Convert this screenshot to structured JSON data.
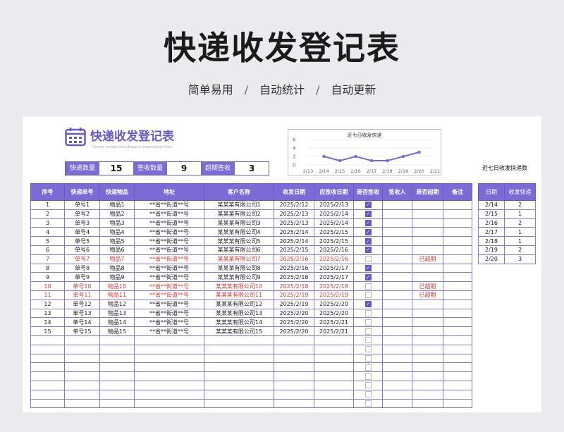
{
  "header": {
    "title": "快递收发登记表",
    "tags": [
      "简单易用",
      "自动统计",
      "自动更新"
    ],
    "separator": "/"
  },
  "sheet": {
    "title": "快递收发登记表",
    "subtitle": "Courier receipt and dispatch registration form",
    "stats": [
      {
        "label": "快递数量",
        "value": "15"
      },
      {
        "label": "签收数量",
        "value": "9"
      },
      {
        "label": "超期签收",
        "value": "3"
      }
    ],
    "side_caption": "近七日收发快递数"
  },
  "columns": [
    "序号",
    "快递单号",
    "快递物品",
    "地址",
    "客户名称",
    "收发日期",
    "应签收日期",
    "是否签收",
    "签收人",
    "是否超期",
    "备注"
  ],
  "rows": [
    [
      "1",
      "单号1",
      "物品1",
      "**省**街道**号",
      "某某某有限公司1",
      "2025/2/12",
      "2025/2/13",
      "on",
      "",
      ""
    ],
    [
      "2",
      "单号2",
      "物品2",
      "**省**街道**号",
      "某某某有限公司2",
      "2025/2/13",
      "2025/2/14",
      "on",
      "",
      ""
    ],
    [
      "3",
      "单号3",
      "物品3",
      "**省**街道**号",
      "某某某有限公司3",
      "2025/2/13",
      "2025/2/14",
      "on",
      "",
      ""
    ],
    [
      "4",
      "单号4",
      "物品4",
      "**省**街道**号",
      "某某某有限公司4",
      "2025/2/14",
      "2025/2/15",
      "on",
      "",
      ""
    ],
    [
      "5",
      "单号5",
      "物品5",
      "**省**街道**号",
      "某某某有限公司5",
      "2025/2/14",
      "2025/2/15",
      "on",
      "",
      ""
    ],
    [
      "6",
      "单号6",
      "物品6",
      "**省**街道**号",
      "某某某有限公司6",
      "2025/2/15",
      "2025/2/16",
      "on",
      "",
      ""
    ],
    [
      "7",
      "单号7",
      "物品7",
      "**省**街道**号",
      "某某某有限公司7",
      "2025/2/16",
      "2025/2/16",
      "off",
      "",
      "已超期"
    ],
    [
      "8",
      "单号8",
      "物品8",
      "**省**街道**号",
      "某某某有限公司8",
      "2025/2/16",
      "2025/2/17",
      "on",
      "",
      ""
    ],
    [
      "9",
      "单号9",
      "物品9",
      "**省**街道**号",
      "某某某有限公司9",
      "2025/2/16",
      "2025/2/17",
      "on",
      "",
      ""
    ],
    [
      "10",
      "单号10",
      "物品10",
      "**省**街道**号",
      "某某某有限公司10",
      "2025/2/18",
      "2025/2/18",
      "off",
      "",
      "已超期"
    ],
    [
      "11",
      "单号11",
      "物品11",
      "**省**街道**号",
      "某某某有限公司11",
      "2025/2/19",
      "2025/2/19",
      "off",
      "",
      "已超期"
    ],
    [
      "12",
      "单号12",
      "物品12",
      "**省**街道**号",
      "某某某有限公司12",
      "2025/2/19",
      "2025/2/20",
      "on",
      "",
      ""
    ],
    [
      "13",
      "单号13",
      "物品13",
      "**省**街道**号",
      "某某某有限公司13",
      "2025/2/20",
      "2025/2/20",
      "off",
      "",
      ""
    ],
    [
      "14",
      "单号14",
      "物品14",
      "**省**街道**号",
      "某某某有限公司14",
      "2025/2/20",
      "2025/2/21",
      "off",
      "",
      ""
    ],
    [
      "15",
      "单号15",
      "物品15",
      "**省**街道**号",
      "某某某有限公司15",
      "2025/2/20",
      "2025/2/21",
      "off",
      "",
      ""
    ]
  ],
  "empty_rows": 8,
  "side_table": {
    "columns": [
      "日期",
      "收发快递"
    ],
    "rows": [
      [
        "2/14",
        "2"
      ],
      [
        "2/15",
        "1"
      ],
      [
        "2/16",
        "2"
      ],
      [
        "2/17",
        "1"
      ],
      [
        "2/18",
        "1"
      ],
      [
        "2/19",
        "2"
      ],
      [
        "2/20",
        "3"
      ]
    ]
  },
  "chart_data": {
    "type": "line",
    "title": "近七日收发快递",
    "categories": [
      "2/13",
      "2/14",
      "2/15",
      "2/16",
      "2/17",
      "2/18",
      "2/19",
      "2/20",
      "2/21"
    ],
    "points": [
      {
        "x": "2/14",
        "y": 2
      },
      {
        "x": "2/15",
        "y": 1
      },
      {
        "x": "2/16",
        "y": 2
      },
      {
        "x": "2/17",
        "y": 1
      },
      {
        "x": "2/18",
        "y": 1
      },
      {
        "x": "2/19",
        "y": 2
      },
      {
        "x": "2/20",
        "y": 3
      }
    ],
    "yticks": [
      0,
      2,
      4,
      6
    ],
    "ylim": [
      0,
      6
    ],
    "color": "#7b6bd6"
  },
  "colors": {
    "accent": "#7b6bd6",
    "overdue": "#d63a3a"
  }
}
